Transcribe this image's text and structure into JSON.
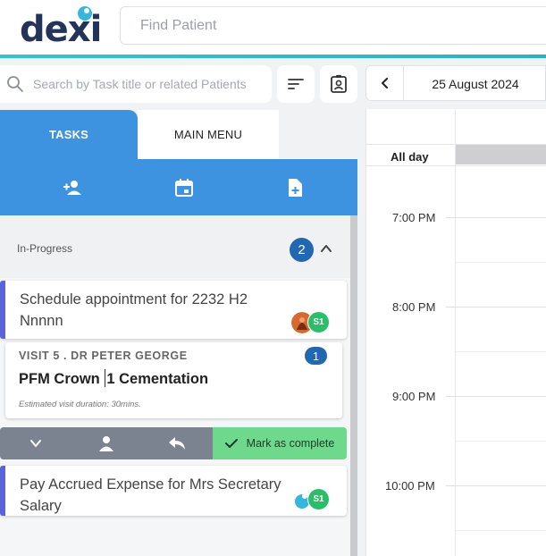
{
  "header": {
    "logo_text": "dexi",
    "find_patient_placeholder": "Find Patient"
  },
  "toolbar": {
    "search_placeholder": "Search by Task title or related Patients"
  },
  "tabs": [
    {
      "label": "TASKS",
      "active": true
    },
    {
      "label": "MAIN MENU",
      "active": false
    }
  ],
  "actions": [
    "add-person-icon",
    "calendar-icon",
    "add-document-icon"
  ],
  "tasks": {
    "section_title": "In-Progress",
    "count": "2",
    "card1": {
      "title": "Schedule appointment for 2232 H2 Nnnnn",
      "assignee": "S1"
    },
    "visit": {
      "label": "VISIT 5 . DR PETER GEORGE",
      "count": "1",
      "title_part1": "PFM Crown",
      "title_part2": "1 Cementation",
      "duration": "Estimated visit duration: 30mins."
    },
    "mark_complete": "Mark as complete",
    "card2": {
      "title": "Pay Accrued Expense for Mrs Secretary Salary",
      "assignee": "S1"
    }
  },
  "calendar": {
    "date": "25 August 2024",
    "all_day": "All day",
    "times": [
      "7:00 PM",
      "8:00 PM",
      "9:00 PM",
      "10:00 PM"
    ]
  },
  "colors": {
    "accent_blue": "#3e93e0",
    "badge_blue": "#2267b2",
    "complete_green": "#6ed98c",
    "assignee_green": "#2bbd6a",
    "task_bar": "#5a63d8"
  }
}
